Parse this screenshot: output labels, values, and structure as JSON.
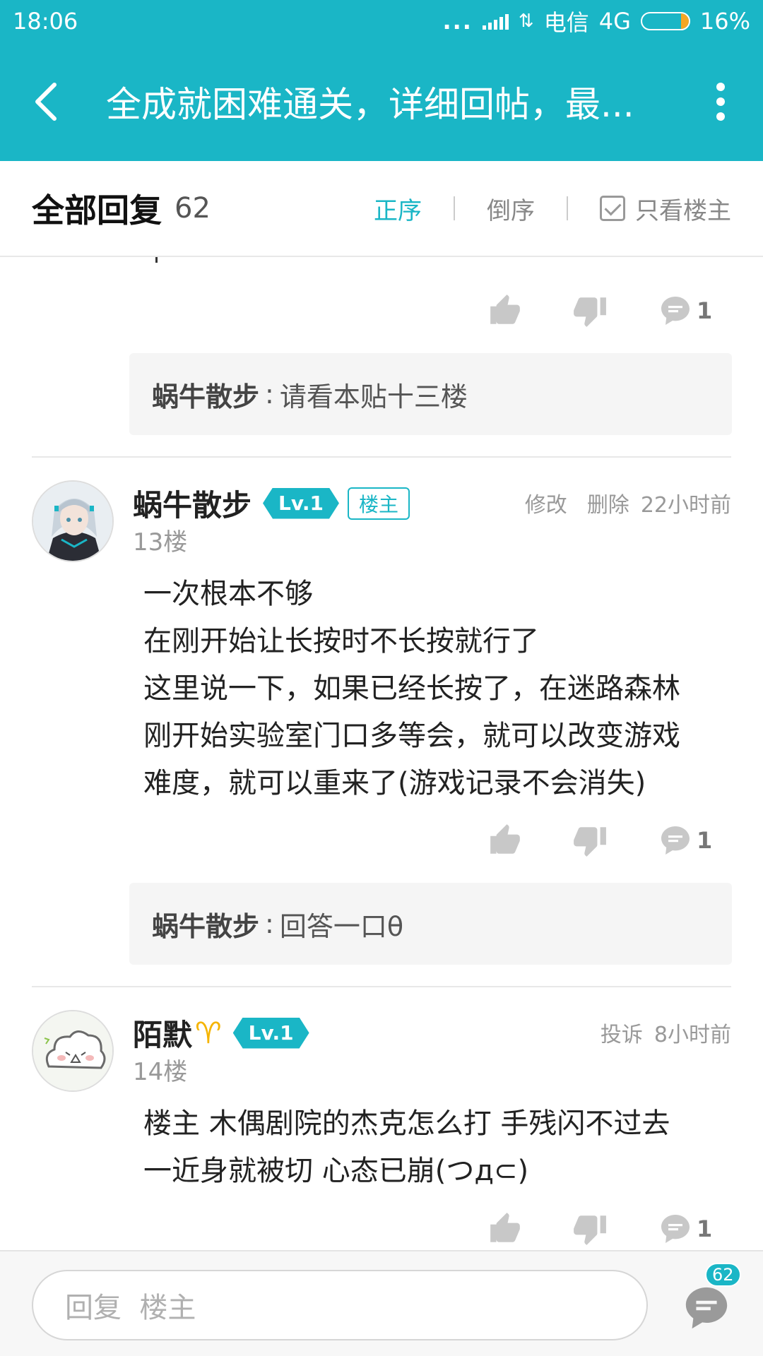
{
  "status_bar": {
    "time": "18:06",
    "dots": "...",
    "carrier": "电信",
    "network": "4G",
    "battery": "16%",
    "battery_level": 0.16
  },
  "header": {
    "title": "全成就困难通关，详细回帖，最..."
  },
  "sort_bar": {
    "title": "全部回复",
    "count": "62",
    "order_asc": "正序",
    "order_desc": "倒序",
    "only_op": "只看楼主",
    "active": "正序"
  },
  "top_item": {
    "comment_count": "1",
    "reply": {
      "author": "蜗牛散步",
      "separator": ":",
      "text": "请看本贴十三楼"
    }
  },
  "posts": [
    {
      "author": "蜗牛散步",
      "level": "Lv.1",
      "op_badge": "楼主",
      "floor": "13楼",
      "actions": [
        "修改",
        "删除"
      ],
      "time": "22小时前",
      "lines": [
        "一次根本不够",
        "在刚开始让长按时不长按就行了",
        "这里说一下，如果已经长按了，在迷路森林",
        "刚开始实验室门口多等会，就可以改变游戏",
        "难度，就可以重来了(游戏记录不会消失)"
      ],
      "comment_count": "1",
      "reply": {
        "author": "蜗牛散步",
        "separator": ":",
        "text": "回答一口θ"
      }
    },
    {
      "author": "陌默",
      "zodiac": "♈",
      "level": "Lv.1",
      "floor": "14楼",
      "actions": [
        "投诉"
      ],
      "time": "8小时前",
      "lines": [
        "楼主 木偶剧院的杰克怎么打  手残闪不过去",
        "一近身就被切  心态已崩(つд⊂)"
      ],
      "comment_count": "1"
    }
  ],
  "bottom_bar": {
    "placeholder": "回复  楼主",
    "badge_count": "62"
  },
  "colors": {
    "accent": "#1ab6c6",
    "badge_gold": "#f5b400",
    "battery": "#f5a623"
  },
  "icons": [
    "back-arrow-icon",
    "more-vert-icon",
    "thumb-up-icon",
    "thumb-down-icon",
    "comment-icon",
    "checkbox-icon",
    "signal-icon",
    "battery-icon"
  ]
}
